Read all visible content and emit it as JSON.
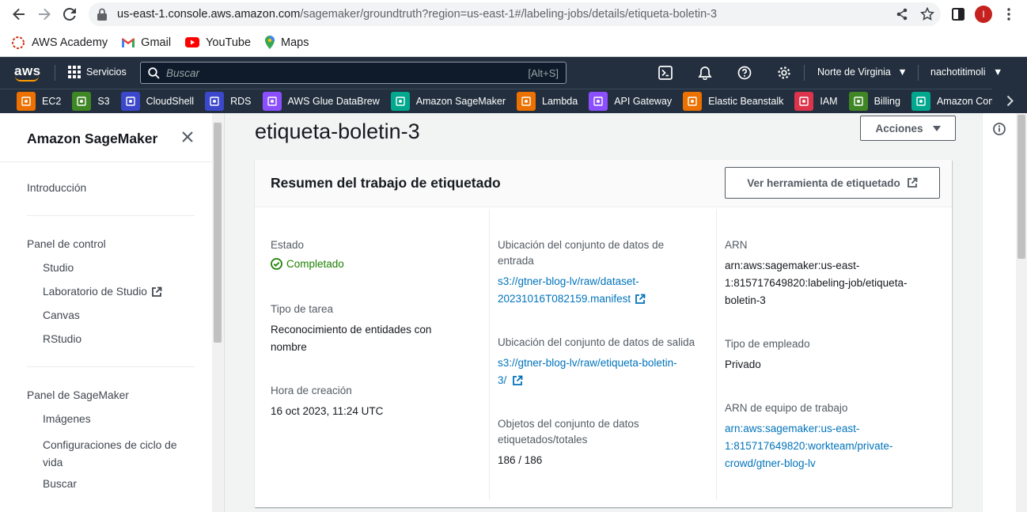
{
  "browser": {
    "url_host": "us-east-1.console.aws.amazon.com",
    "url_path": "/sagemaker/groundtruth?region=us-east-1#/labeling-jobs/details/etiqueta-boletin-3",
    "profile_initial": "I",
    "bookmarks": [
      {
        "label": "AWS Academy",
        "icon": "aws-academy-icon"
      },
      {
        "label": "Gmail",
        "icon": "gmail-icon"
      },
      {
        "label": "YouTube",
        "icon": "youtube-icon"
      },
      {
        "label": "Maps",
        "icon": "maps-icon"
      }
    ]
  },
  "aws_nav": {
    "logo": "aws",
    "services_label": "Servicios",
    "search_placeholder": "Buscar",
    "search_shortcut": "[Alt+S]",
    "region": "Norte de Virginia",
    "user": "nachotitimoli"
  },
  "favorites": [
    {
      "label": "EC2",
      "color": "#ed7100"
    },
    {
      "label": "S3",
      "color": "#3f8624"
    },
    {
      "label": "CloudShell",
      "color": "#3b48cc"
    },
    {
      "label": "RDS",
      "color": "#3b48cc"
    },
    {
      "label": "AWS Glue DataBrew",
      "color": "#8c4fff"
    },
    {
      "label": "Amazon SageMaker",
      "color": "#01a88d"
    },
    {
      "label": "Lambda",
      "color": "#ed7100"
    },
    {
      "label": "API Gateway",
      "color": "#8c4fff"
    },
    {
      "label": "Elastic Beanstalk",
      "color": "#ed7100"
    },
    {
      "label": "IAM",
      "color": "#dd344c"
    },
    {
      "label": "Billing",
      "color": "#3f8624"
    },
    {
      "label": "Amazon Compret",
      "color": "#01a88d"
    }
  ],
  "sidebar": {
    "title": "Amazon SageMaker",
    "intro": "Introducción",
    "panel_control": "Panel de control",
    "studio": "Studio",
    "lab_studio": "Laboratorio de Studio",
    "canvas": "Canvas",
    "rstudio": "RStudio",
    "panel_sagemaker": "Panel de SageMaker",
    "imagenes": "Imágenes",
    "config_line1": "Configuraciones de ciclo de",
    "config_line2": "vida",
    "buscar": "Buscar"
  },
  "main": {
    "title": "etiqueta-boletin-3",
    "actions_label": "Acciones",
    "card_title": "Resumen del trabajo de etiquetado",
    "view_tool_label": "Ver herramienta de etiquetado",
    "col1": {
      "estado_label": "Estado",
      "estado_value": "Completado",
      "tipo_label": "Tipo de tarea",
      "tipo_value_l1": "Reconocimiento de entidades con",
      "tipo_value_l2": "nombre",
      "hora_label": "Hora de creación",
      "hora_value": "16 oct 2023, 11:24 UTC"
    },
    "col2": {
      "entrada_label_l1": "Ubicación del conjunto de datos de",
      "entrada_label_l2": "entrada",
      "entrada_link_l1": "s3://gtner-blog-lv/raw/dataset-",
      "entrada_link_l2": "20231016T082159.manifest",
      "salida_label": "Ubicación del conjunto de datos de salida",
      "salida_link_l1": "s3://gtner-blog-lv/raw/etiqueta-boletin-",
      "salida_link_l2": "3/",
      "objetos_label_l1": "Objetos del conjunto de datos",
      "objetos_label_l2": "etiquetados/totales",
      "objetos_value": "186 / 186"
    },
    "col3": {
      "arn_label": "ARN",
      "arn_l1": "arn:aws:sagemaker:us-east-",
      "arn_l2": "1:815717649820:labeling-job/etiqueta-",
      "arn_l3": "boletin-3",
      "empleado_label": "Tipo de empleado",
      "empleado_value": "Privado",
      "equipo_label": "ARN de equipo de trabajo",
      "equipo_l1": "arn:aws:sagemaker:us-east-",
      "equipo_l2": "1:815717649820:workteam/private-",
      "equipo_l3": "crowd/gtner-blog-lv"
    }
  }
}
